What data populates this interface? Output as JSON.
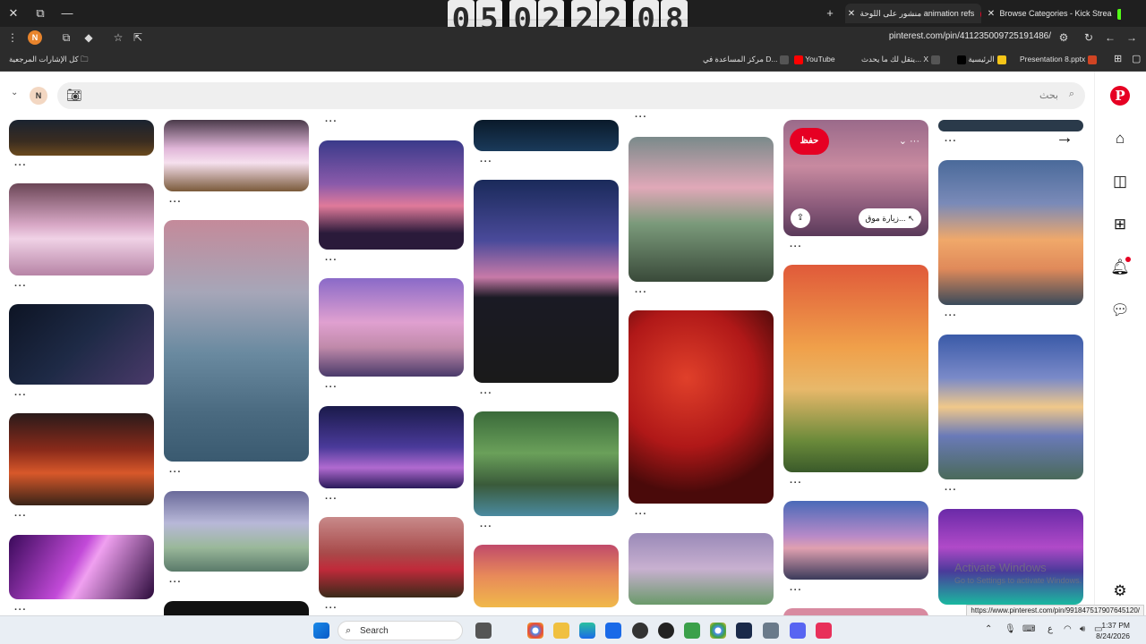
{
  "window": {
    "tabs": [
      {
        "label": "Browse Categories - Kick Strea",
        "active": false
      },
      {
        "label": "منشور على اللوحة animation refs",
        "active": true
      }
    ],
    "new_tab": "+",
    "clock_digits": [
      "0",
      "5",
      "0",
      "2",
      "2",
      "2",
      "0",
      "8"
    ]
  },
  "addressbar": {
    "url": "pinterest.com/pin/411235009725191486/",
    "profile_initial": "N"
  },
  "bookmarks": {
    "all_bookmarks": "كل الإشارات المرجعية",
    "items": [
      {
        "label": "Presentation 8.pptx",
        "color": "#d04423"
      },
      {
        "label": "الرئيسية",
        "color": "#f5c518"
      },
      {
        "label": "X",
        "color": "#000000"
      },
      {
        "label": "يتقل لك ما يحدث... X",
        "color": "#555555"
      },
      {
        "label": "YouTube",
        "color": "#ff0000"
      },
      {
        "label": "مركز المساعدة في D...",
        "color": "#555555"
      }
    ]
  },
  "pinterest": {
    "search_placeholder": "بحث",
    "avatar_initial": "N",
    "save_label": "حفظ",
    "visit_label": "زيارة موق...",
    "more_dots": "···",
    "arrow": "→",
    "activate_title": "Activate Windows",
    "activate_sub": "Go to Settings to activate Windows.",
    "status_url": "https://www.pinterest.com/pin/991847517907645120/",
    "accent": "#e60023"
  },
  "taskbar": {
    "search_label": "Search",
    "time": "1:37 PM",
    "date": "8/24/2026",
    "lang": "ع"
  }
}
